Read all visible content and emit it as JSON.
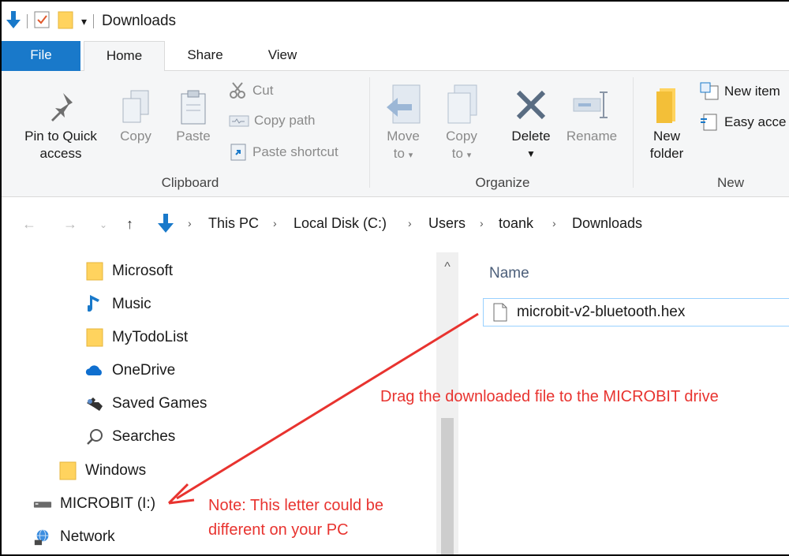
{
  "window": {
    "title": "Downloads"
  },
  "ribbon_tabs": [
    {
      "label": "File"
    },
    {
      "label": "Home"
    },
    {
      "label": "Share"
    },
    {
      "label": "View"
    }
  ],
  "clipboard": {
    "group_label": "Clipboard",
    "pin_line1": "Pin to Quick",
    "pin_line2": "access",
    "copy": "Copy",
    "paste": "Paste",
    "cut": "Cut",
    "copy_path": "Copy path",
    "paste_shortcut": "Paste shortcut"
  },
  "organize": {
    "group_label": "Organize",
    "move_line1": "Move",
    "move_line2": "to",
    "copy_line1": "Copy",
    "copy_line2": "to",
    "delete": "Delete",
    "rename": "Rename"
  },
  "new_group": {
    "group_label": "New",
    "folder_line1": "New",
    "folder_line2": "folder",
    "new_item": "New item",
    "easy_access": "Easy acce"
  },
  "breadcrumb": [
    "This PC",
    "Local Disk (C:)",
    "Users",
    "toank",
    "Downloads"
  ],
  "nav_items": [
    {
      "label": "Microsoft",
      "icon": "folder-icon"
    },
    {
      "label": "Music",
      "icon": "music-icon"
    },
    {
      "label": "MyTodoList",
      "icon": "folder-icon"
    },
    {
      "label": "OneDrive",
      "icon": "onedrive-icon"
    },
    {
      "label": "Saved Games",
      "icon": "saved-games-icon"
    },
    {
      "label": "Searches",
      "icon": "search-icon"
    },
    {
      "label": "Windows",
      "icon": "folder-icon"
    },
    {
      "label": "MICROBIT (I:)",
      "icon": "drive-icon"
    },
    {
      "label": "Network",
      "icon": "network-icon"
    }
  ],
  "file_list": {
    "column_name": "Name",
    "files": [
      {
        "name": "microbit-v2-bluetooth.hex",
        "icon": "file-icon"
      }
    ]
  },
  "annotations": {
    "drag_note": "Drag the downloaded file to the MICROBIT drive",
    "letter_note_line1": "Note: This letter could be",
    "letter_note_line2": "different on your PC"
  },
  "colors": {
    "accent": "#1979ca",
    "annotation": "#e8332f",
    "folder": "#ffd35e",
    "selection_border": "#99d1ff"
  }
}
